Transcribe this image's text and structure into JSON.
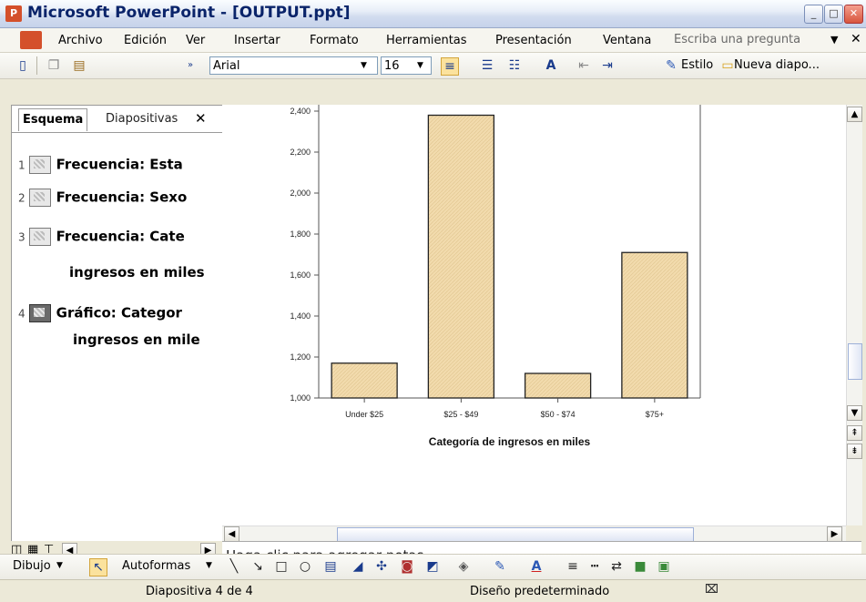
{
  "window": {
    "title": "Microsoft PowerPoint - [OUTPUT.ppt]"
  },
  "menu": {
    "items": [
      "Archivo",
      "Edición",
      "Ver",
      "Insertar",
      "Formato",
      "Herramientas",
      "Presentación",
      "Ventana"
    ],
    "help_placeholder": "Escriba una pregunta"
  },
  "toolbar": {
    "font_name": "Arial",
    "font_size": "16",
    "design_label": "Estilo",
    "new_slide_label": "Nueva diapo..."
  },
  "left_pane": {
    "tabs": [
      "Esquema",
      "Diapositivas"
    ],
    "slides": [
      {
        "num": "1",
        "title": "Frecuencia: Esta",
        "title2": ""
      },
      {
        "num": "2",
        "title": "Frecuencia: Sexo",
        "title2": ""
      },
      {
        "num": "3",
        "title": "Frecuencia: Cate",
        "title2": "ingresos en miles"
      },
      {
        "num": "4",
        "title": "Gráfico: Categor",
        "title2": "ingresos en mile"
      }
    ]
  },
  "chart_data": {
    "type": "bar",
    "categories": [
      "Under $25",
      "$25 - $49",
      "$50 - $74",
      "$75+"
    ],
    "values": [
      1170,
      2380,
      1120,
      1710
    ],
    "ytick_labels": [
      "1,000",
      "1,200",
      "1,400",
      "1,600",
      "1,800",
      "2,000",
      "2,200",
      "2,400"
    ],
    "ylim": [
      1000,
      2400
    ],
    "xlabel": "Categoría de ingresos en miles",
    "ylabel": "",
    "bar_color": "#f2dbad",
    "grid": false
  },
  "notes": {
    "placeholder": "Haga clic para agregar notas"
  },
  "drawing_toolbar": {
    "draw_label": "Dibujo",
    "autoshapes_label": "Autoformas"
  },
  "status": {
    "slide_info": "Diapositiva 4 de 4",
    "design": "Diseño predeterminado"
  }
}
